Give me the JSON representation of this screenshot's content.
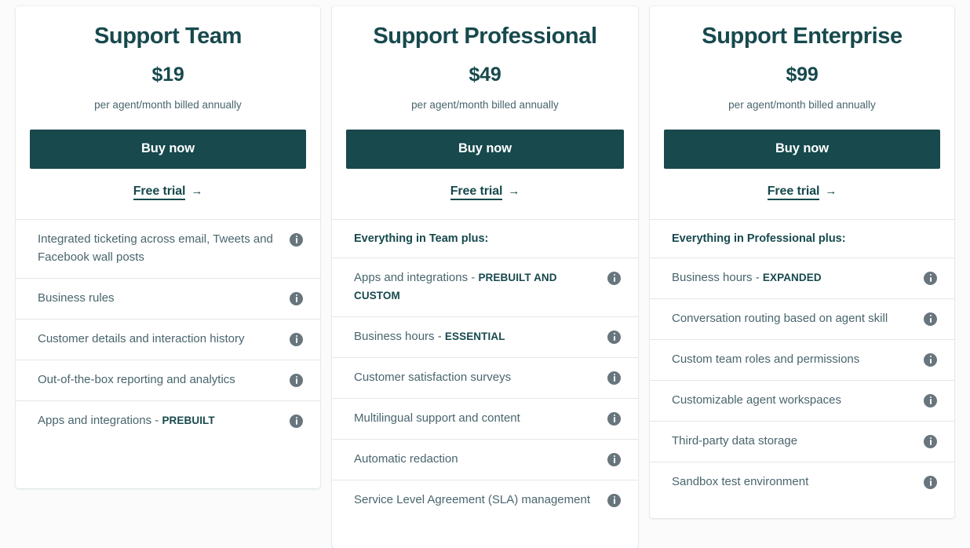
{
  "page": {
    "background_color": "#fbfbfb",
    "brand_dark_color": "#17494d",
    "body_text_color": "#49656d",
    "info_icon_color": "#68757d",
    "divider_color": "#e4e8e8"
  },
  "plans": [
    {
      "name": "Support Team",
      "price": "$19",
      "billing_note": "per agent/month billed annually",
      "buy_label": "Buy now",
      "trial_label": "Free trial",
      "trial_arrow": "→",
      "features": [
        {
          "text": "Integrated ticketing across email, Tweets and Facebook wall posts",
          "emphasis": "",
          "group_header": false,
          "has_info": true
        },
        {
          "text": "Business rules",
          "emphasis": "",
          "group_header": false,
          "has_info": true
        },
        {
          "text": "Customer details and interaction history",
          "emphasis": "",
          "group_header": false,
          "has_info": true
        },
        {
          "text": "Out-of-the-box reporting and analytics",
          "emphasis": "",
          "group_header": false,
          "has_info": true
        },
        {
          "text": "Apps and integrations - ",
          "emphasis": "PREBUILT",
          "group_header": false,
          "has_info": true
        }
      ]
    },
    {
      "name": "Support Professional",
      "price": "$49",
      "billing_note": "per agent/month billed annually",
      "buy_label": "Buy now",
      "trial_label": "Free trial",
      "trial_arrow": "→",
      "features": [
        {
          "text": "Everything in Team plus:",
          "emphasis": "",
          "group_header": true,
          "has_info": false
        },
        {
          "text": "Apps and integrations - ",
          "emphasis": "PREBUILT AND CUSTOM",
          "group_header": false,
          "has_info": true
        },
        {
          "text": "Business hours - ",
          "emphasis": "ESSENTIAL",
          "group_header": false,
          "has_info": true
        },
        {
          "text": "Customer satisfaction surveys",
          "emphasis": "",
          "group_header": false,
          "has_info": true
        },
        {
          "text": "Multilingual support and content",
          "emphasis": "",
          "group_header": false,
          "has_info": true
        },
        {
          "text": "Automatic redaction",
          "emphasis": "",
          "group_header": false,
          "has_info": true
        },
        {
          "text": "Service Level Agreement (SLA) management",
          "emphasis": "",
          "group_header": false,
          "has_info": true
        }
      ]
    },
    {
      "name": "Support Enterprise",
      "price": "$99",
      "billing_note": "per agent/month billed annually",
      "buy_label": "Buy now",
      "trial_label": "Free trial",
      "trial_arrow": "→",
      "features": [
        {
          "text": "Everything in Professional plus:",
          "emphasis": "",
          "group_header": true,
          "has_info": false
        },
        {
          "text": "Business hours - ",
          "emphasis": "EXPANDED",
          "group_header": false,
          "has_info": true
        },
        {
          "text": "Conversation routing based on agent skill",
          "emphasis": "",
          "group_header": false,
          "has_info": true
        },
        {
          "text": "Custom team roles and permissions",
          "emphasis": "",
          "group_header": false,
          "has_info": true
        },
        {
          "text": "Customizable agent workspaces",
          "emphasis": "",
          "group_header": false,
          "has_info": true
        },
        {
          "text": "Third-party data storage",
          "emphasis": "",
          "group_header": false,
          "has_info": true
        },
        {
          "text": "Sandbox test environment",
          "emphasis": "",
          "group_header": false,
          "has_info": true
        }
      ]
    }
  ]
}
